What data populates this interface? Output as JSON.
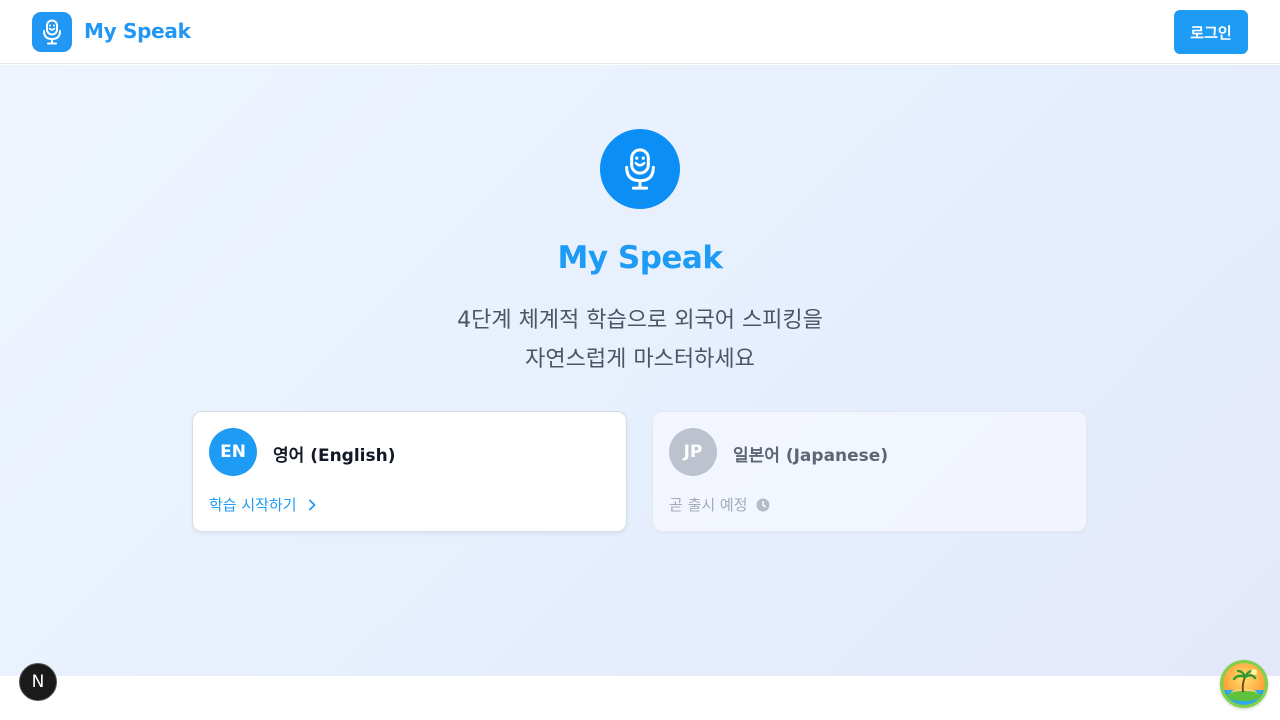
{
  "header": {
    "brand": "My Speak",
    "logo_icon": "microphone-smile-icon",
    "login_label": "로그인"
  },
  "hero": {
    "icon": "microphone-smile-icon",
    "title": "My Speak",
    "subtitle_line1": "4단계 체계적 학습으로 외국어 스피킹을",
    "subtitle_line2": "자연스럽게 마스터하세요"
  },
  "languages": [
    {
      "code": "EN",
      "name": "영어 (English)",
      "action": "학습 시작하기",
      "action_icon": "chevron-right-icon",
      "available": true
    },
    {
      "code": "JP",
      "name": "일본어 (Japanese)",
      "status": "곧 출시 예정",
      "status_icon": "clock-icon",
      "available": false
    }
  ],
  "floating": {
    "dev_badge_letter": "N",
    "assistant_icon": "island-palm-icon"
  },
  "colors": {
    "accent": "#1e9bf5",
    "hero_icon_bg": "#0b8ef5",
    "disabled_badge": "#bcc2ce",
    "text_muted": "#4b5563"
  }
}
